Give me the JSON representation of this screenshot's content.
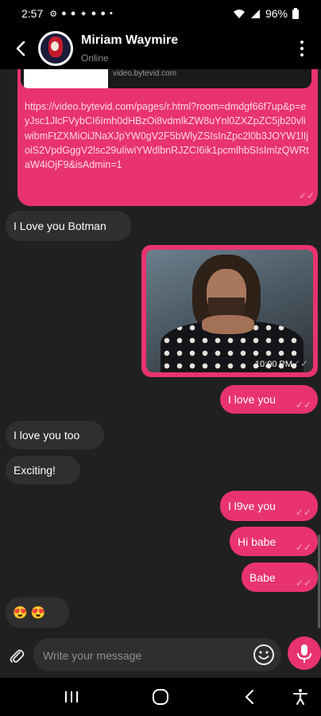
{
  "status_bar": {
    "time": "2:57",
    "notification_icons": [
      "settings-icon",
      "messenger-icon",
      "pinterest-icon",
      "twitter-icon",
      "vpn-icon",
      "lock-icon",
      "dot-icon"
    ],
    "battery": "96%"
  },
  "header": {
    "contact_name": "Miriam Waymire",
    "presence": "Online"
  },
  "messages": [
    {
      "id": "m1",
      "direction": "outgoing",
      "type": "link",
      "preview_domain": "video.bytevid.com",
      "text": "https://video.bytevid.com/pages/r.html?room=dmdgf66f7up&p=eyJsc1JlcFVybCI6Imh0dHBzOi8vdmlkZW8uYnl0ZXZpZC5jb20vliwibmFtZXMiOiJNaXJpYW0gV2F5bWlyZSIsInZpc2l0b3JOYW1lIjoiS2VpdGggV2lsc29uIiwiYWdlbnRJZCI6ik1pcmlhbSIsImlzQWRtaW4iOjF9&isAdmin=1",
      "read": true
    },
    {
      "id": "m2",
      "direction": "incoming",
      "type": "text",
      "text": "I Love you Botman"
    },
    {
      "id": "m3",
      "direction": "outgoing",
      "type": "image",
      "image_subject": "man with long hair making heart hands",
      "time": "10:00 PM",
      "read": true
    },
    {
      "id": "m4",
      "direction": "outgoing",
      "type": "text",
      "text": "I love you",
      "read": true
    },
    {
      "id": "m5",
      "direction": "incoming",
      "type": "text",
      "text": "I love you too"
    },
    {
      "id": "m6",
      "direction": "incoming",
      "type": "text",
      "text": "Exciting!"
    },
    {
      "id": "m7",
      "direction": "outgoing",
      "type": "text",
      "text": "I l9ve you",
      "read": true
    },
    {
      "id": "m8",
      "direction": "outgoing",
      "type": "text",
      "text": "Hi babe",
      "read": true
    },
    {
      "id": "m9",
      "direction": "outgoing",
      "type": "text",
      "text": "Babe",
      "read": true
    },
    {
      "id": "m10",
      "direction": "incoming",
      "type": "emoji",
      "text": "😍 😍"
    }
  ],
  "composer": {
    "placeholder": "Write your message",
    "value": ""
  },
  "colors": {
    "accent": "#e8336f",
    "background": "#202020",
    "incoming_bubble": "#2f2f2f",
    "bars": "#000000"
  },
  "icons": {
    "back": "back-arrow-icon",
    "menu": "more-vert-icon",
    "attach": "paperclip-icon",
    "emoji": "smiley-icon",
    "mic": "microphone-icon",
    "nav": [
      "recent-apps-icon",
      "home-icon",
      "back-icon",
      "accessibility-icon"
    ]
  }
}
